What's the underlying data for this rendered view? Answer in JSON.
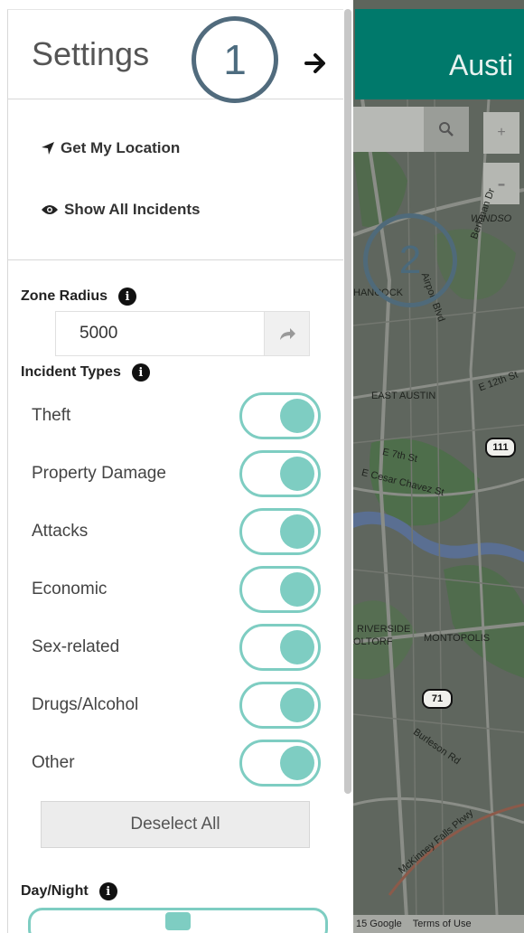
{
  "settings": {
    "title": "Settings",
    "marker_number": "1",
    "collapse_icon": "arrow-right-icon",
    "get_location_label": "Get My Location",
    "show_incidents_label": "Show All Incidents",
    "zone_radius": {
      "label": "Zone Radius",
      "value": "5000"
    },
    "incident_types": {
      "label": "Incident Types",
      "items": [
        {
          "label": "Theft",
          "enabled": true
        },
        {
          "label": "Property Damage",
          "enabled": true
        },
        {
          "label": "Attacks",
          "enabled": true
        },
        {
          "label": "Economic",
          "enabled": true
        },
        {
          "label": "Sex-related",
          "enabled": true
        },
        {
          "label": "Drugs/Alcohol",
          "enabled": true
        },
        {
          "label": "Other",
          "enabled": true
        }
      ]
    },
    "deselect_all_label": "Deselect All",
    "day_night": {
      "label": "Day/Night",
      "level": 0.5
    }
  },
  "map": {
    "title": "Austi",
    "marker_number": "2",
    "zoom_in_label": "+",
    "zoom_out_label": "-",
    "labels": {
      "windsor": "WINDSO",
      "hancock": "HANCOCK",
      "berkman": "Berkman Dr",
      "airport": "Airport Blvd",
      "e12th": "E 12th St",
      "east_austin": "EAST AUSTIN",
      "e7th": "E 7th St",
      "cesar": "E Cesar Chavez St",
      "riverside": "RIVERSIDE",
      "oltorf": "OLTORF",
      "montopolis": "MONTOPOLIS",
      "burleson": "Burleson Rd",
      "mckinney": "McKinney Falls Pkwy"
    },
    "shields": {
      "s111": "111",
      "s71": "71"
    },
    "attribution": {
      "google": "15 Google",
      "terms": "Terms of Use"
    }
  },
  "colors": {
    "accent_teal": "#7ecdc2",
    "header_teal": "#00796b",
    "marker_outline": "#516b7d"
  }
}
